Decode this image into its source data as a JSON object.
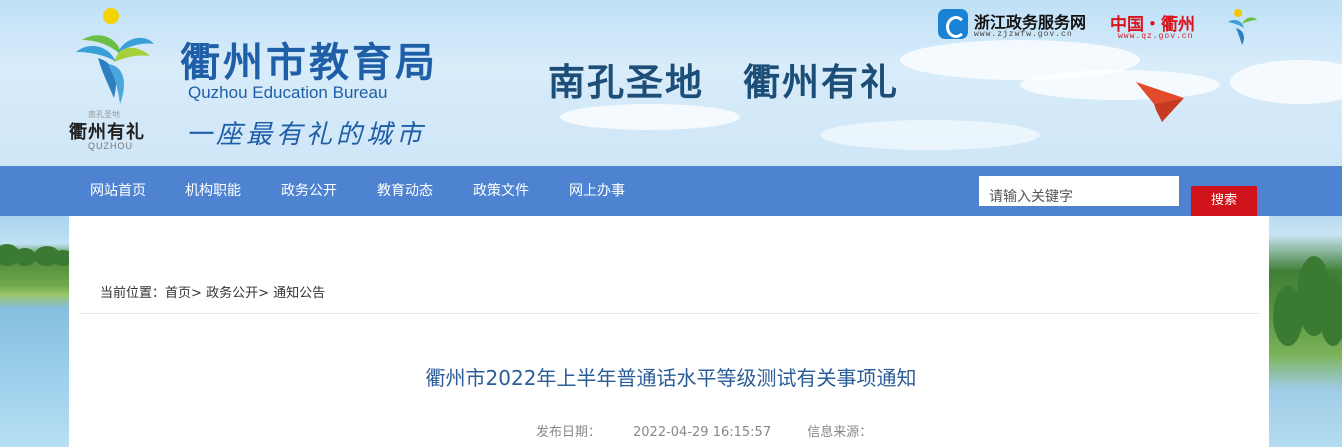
{
  "header": {
    "site_title": "衢州市教育局",
    "site_title_en": "Quzhou Education Bureau",
    "slogan_script": "一座最有礼的城市",
    "logo_small_text": "南孔圣地",
    "logo_city": "衢州有礼",
    "logo_city_en": "QUZHOU",
    "tagline": "南孔圣地　衢州有礼",
    "zj_link": {
      "name": "浙江政务服务网",
      "url": "www.zjzwfw.gov.cn"
    },
    "qz_link": {
      "name": "中国・衢州",
      "url": "www.qz.gov.cn"
    }
  },
  "nav": {
    "items": [
      {
        "label": "网站首页"
      },
      {
        "label": "机构职能"
      },
      {
        "label": "政务公开"
      },
      {
        "label": "教育动态"
      },
      {
        "label": "政策文件"
      },
      {
        "label": "网上办事"
      }
    ]
  },
  "search": {
    "placeholder": "请输入关键字",
    "button_label": "搜索"
  },
  "breadcrumb": {
    "prefix": "当前位置：",
    "items": [
      "首页",
      "政务公开",
      "通知公告"
    ],
    "separator": ">"
  },
  "article": {
    "title": "衢州市2022年上半年普通话水平等级测试有关事项通知",
    "date_label": "发布日期：",
    "date": "2022-04-29 16:15:57",
    "source_label": "信息来源："
  },
  "colors": {
    "nav_bg": "#4e83d2",
    "title_blue": "#1f5fa8",
    "search_button": "#d0121b",
    "article_title": "#2a5d97"
  },
  "icons": [
    "zjzwfw-logo-icon",
    "quzhou-emblem-icon",
    "paper-plane-icon",
    "education-bureau-logo-icon"
  ]
}
